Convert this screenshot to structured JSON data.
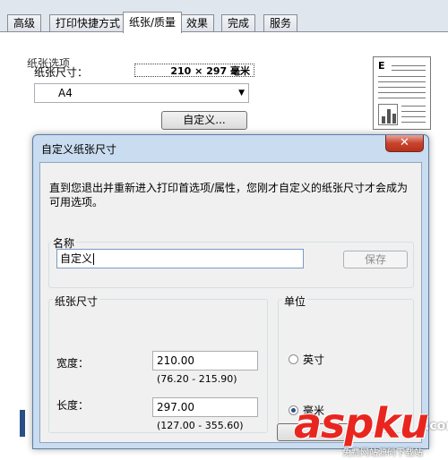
{
  "tabs": [
    {
      "label": "高级",
      "active": false
    },
    {
      "label": "打印快捷方式",
      "active": false
    },
    {
      "label": "纸张/质量",
      "active": true
    },
    {
      "label": "效果",
      "active": false
    },
    {
      "label": "完成",
      "active": false
    },
    {
      "label": "服务",
      "active": false
    }
  ],
  "paper": {
    "group_title": "纸张选项",
    "size_label": "纸张尺寸：",
    "size_value": "210 × 297 毫米",
    "selected": "A4",
    "custom_button": "自定义..."
  },
  "dialog": {
    "title": "自定义纸张尺寸",
    "close_glyph": "✕",
    "info": "直到您退出并重新进入打印首选项/属性，您刚才自定义的纸张尺寸才会成为可用选项。",
    "name_group_title": "名称",
    "name_value": "自定义",
    "save_label": "保存",
    "size_group_title": "纸张尺寸",
    "width_label": "宽度：",
    "width_value": "210.00",
    "width_range": "(76.20 - 215.90)",
    "length_label": "长度：",
    "length_value": "297.00",
    "length_range": "(127.00 - 355.60)",
    "unit_group_title": "单位",
    "unit_inch": "英寸",
    "unit_mm": "毫米",
    "selected_unit": "mm"
  },
  "watermark": {
    "logo": "aspku",
    "suffix": ".com",
    "tagline": "免费网站源码下载站"
  },
  "colors": {
    "dialog_frame": "#c9dcf0",
    "close_red": "#c8432d",
    "radio_dot": "#2a4f86",
    "watermark_red": "#e8261f"
  }
}
